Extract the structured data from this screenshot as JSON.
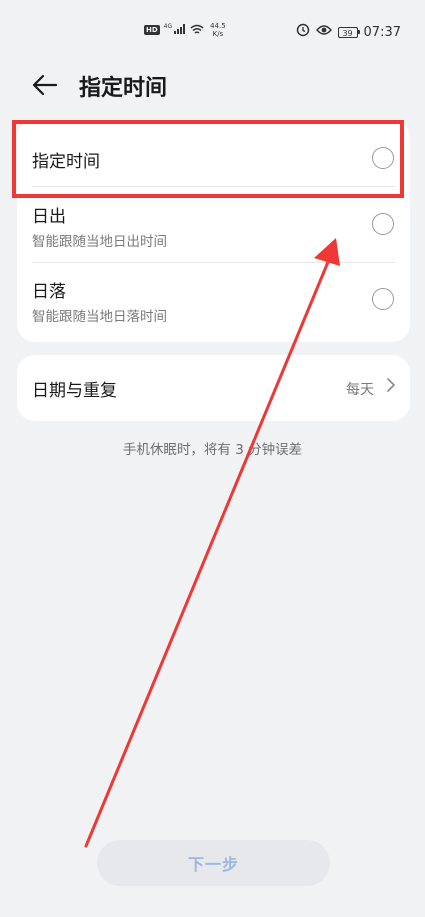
{
  "status_bar": {
    "hd_badge": "HD",
    "network_gen": "4G",
    "speed_value": "44.5",
    "speed_unit": "K/s",
    "battery": "39",
    "time": "07:37"
  },
  "header": {
    "title": "指定时间"
  },
  "time_options": [
    {
      "title": "指定时间",
      "subtitle": ""
    },
    {
      "title": "日出",
      "subtitle": "智能跟随当地日出时间"
    },
    {
      "title": "日落",
      "subtitle": "智能跟随当地日落时间"
    }
  ],
  "date_repeat": {
    "label": "日期与重复",
    "value": "每天"
  },
  "note": "手机休眠时，将有 3 分钟误差",
  "next_button": "下一步",
  "colors": {
    "highlight": "#ee3737",
    "arrow": "#ee3737",
    "button_text": "#9bb7e0"
  }
}
